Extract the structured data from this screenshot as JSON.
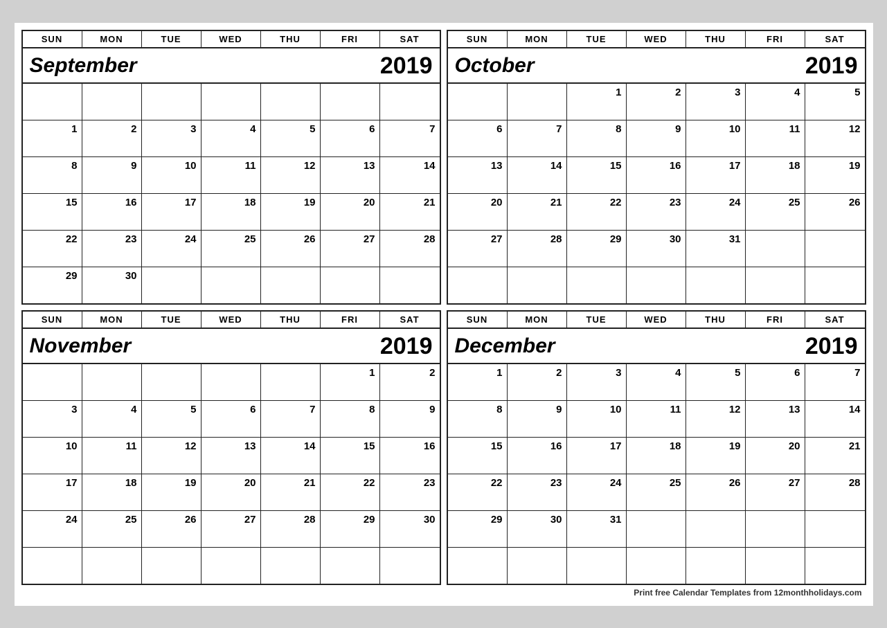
{
  "calendars": [
    {
      "id": "september",
      "month": "September",
      "year": "2019",
      "days_header": [
        "SUN",
        "MON",
        "TUE",
        "WED",
        "THU",
        "FRI",
        "SAT"
      ],
      "weeks": [
        [
          "",
          "",
          "",
          "",
          "",
          "",
          ""
        ],
        [
          "1",
          "2",
          "3",
          "4",
          "5",
          "6",
          "7"
        ],
        [
          "8",
          "9",
          "10",
          "11",
          "12",
          "13",
          "14"
        ],
        [
          "15",
          "16",
          "17",
          "18",
          "19",
          "20",
          "21"
        ],
        [
          "22",
          "23",
          "24",
          "25",
          "26",
          "27",
          "28"
        ],
        [
          "29",
          "30",
          "",
          "",
          "",
          "",
          ""
        ]
      ]
    },
    {
      "id": "october",
      "month": "October",
      "year": "2019",
      "days_header": [
        "SUN",
        "MON",
        "TUE",
        "WED",
        "THU",
        "FRI",
        "SAT"
      ],
      "weeks": [
        [
          "",
          "",
          "1",
          "2",
          "3",
          "4",
          "5"
        ],
        [
          "6",
          "7",
          "8",
          "9",
          "10",
          "11",
          "12"
        ],
        [
          "13",
          "14",
          "15",
          "16",
          "17",
          "18",
          "19"
        ],
        [
          "20",
          "21",
          "22",
          "23",
          "24",
          "25",
          "26"
        ],
        [
          "27",
          "28",
          "29",
          "30",
          "31",
          "",
          ""
        ],
        [
          "",
          "",
          "",
          "",
          "",
          "",
          ""
        ]
      ]
    },
    {
      "id": "november",
      "month": "November",
      "year": "2019",
      "days_header": [
        "SUN",
        "MON",
        "TUE",
        "WED",
        "THU",
        "FRI",
        "SAT"
      ],
      "weeks": [
        [
          "",
          "",
          "",
          "",
          "",
          "1",
          "2"
        ],
        [
          "3",
          "4",
          "5",
          "6",
          "7",
          "8",
          "9"
        ],
        [
          "10",
          "11",
          "12",
          "13",
          "14",
          "15",
          "16"
        ],
        [
          "17",
          "18",
          "19",
          "20",
          "21",
          "22",
          "23"
        ],
        [
          "24",
          "25",
          "26",
          "27",
          "28",
          "29",
          "30"
        ],
        [
          "",
          "",
          "",
          "",
          "",
          "",
          ""
        ]
      ]
    },
    {
      "id": "december",
      "month": "December",
      "year": "2019",
      "days_header": [
        "SUN",
        "MON",
        "TUE",
        "WED",
        "THU",
        "FRI",
        "SAT"
      ],
      "weeks": [
        [
          "1",
          "2",
          "3",
          "4",
          "5",
          "6",
          "7"
        ],
        [
          "8",
          "9",
          "10",
          "11",
          "12",
          "13",
          "14"
        ],
        [
          "15",
          "16",
          "17",
          "18",
          "19",
          "20",
          "21"
        ],
        [
          "22",
          "23",
          "24",
          "25",
          "26",
          "27",
          "28"
        ],
        [
          "29",
          "30",
          "31",
          "",
          "",
          "",
          ""
        ],
        [
          "",
          "",
          "",
          "",
          "",
          "",
          ""
        ]
      ]
    }
  ],
  "footer": {
    "text": "Print free Calendar Templates from ",
    "brand": "12monthholidays.com"
  }
}
